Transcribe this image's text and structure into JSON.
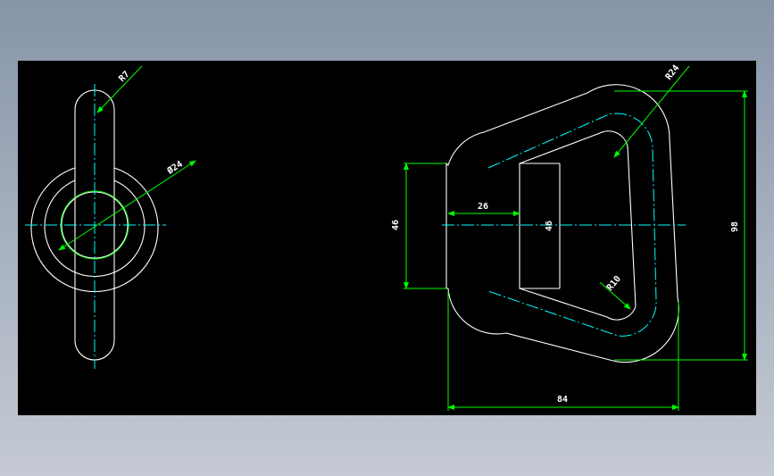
{
  "colors": {
    "background": "#000000",
    "outline": "#ffffff",
    "dimension": "#00ff00",
    "centerline": "#00ffff"
  },
  "dimensions": {
    "r7": "R7",
    "dia24": "Ø24",
    "r24": "R24",
    "d46_left": "46",
    "d26": "26",
    "d46_mid": "46",
    "d98": "98",
    "r10": "R10",
    "d84": "84"
  }
}
